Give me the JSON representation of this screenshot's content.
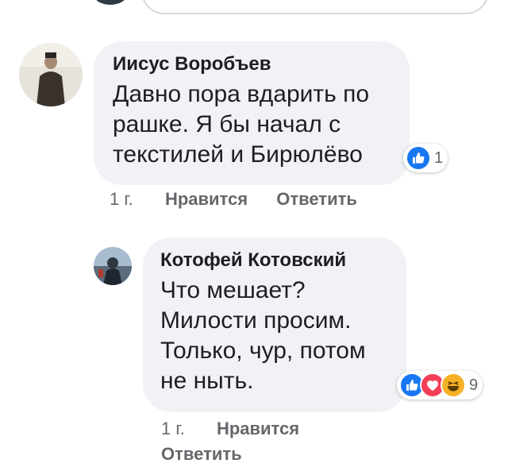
{
  "comments": [
    {
      "author": "Иисус Воробъев",
      "text": "Давно пора вдарить по\nрашке. Я бы начал с\nтекстилей и Бирюлёво",
      "time": "1 г.",
      "like_label": "Нравится",
      "reply_label": "Ответить",
      "reactions": {
        "icons": [
          "like-icon"
        ],
        "count": "1"
      }
    },
    {
      "author": "Котофей Котовский",
      "text": "Что мешает?\nМилости просим.\nТолько, чур, потом\nне ныть.",
      "time": "1 г.",
      "like_label": "Нравится",
      "reply_label": "Ответить",
      "reactions": {
        "icons": [
          "like-icon",
          "love-icon",
          "haha-icon"
        ],
        "count": "9"
      }
    }
  ],
  "colors": {
    "bubble": "#f0f2f5",
    "meta_text": "#65676b",
    "like_blue": "#1877f2",
    "love_red": "#f33e58",
    "haha_yellow": "#f7b125"
  }
}
